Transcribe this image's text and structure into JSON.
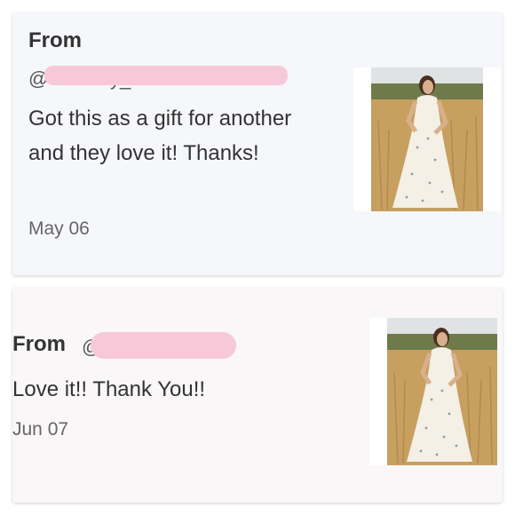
{
  "reviews": [
    {
      "from_label": "From",
      "handle_prefix": "@",
      "handle_suffix": "y_",
      "text": "Got this as a gift for another and they love it! Thanks!",
      "date": "May 06"
    },
    {
      "from_label": "From",
      "handle_prefix": "@",
      "text": "Love it!! Thank You!!",
      "date": "Jun 07"
    }
  ],
  "colors": {
    "redaction": "#f7c9d8",
    "card1_bg": "#f6f7fa",
    "card2_bg": "#faf7f8"
  },
  "icons": [
    "product-photo"
  ]
}
